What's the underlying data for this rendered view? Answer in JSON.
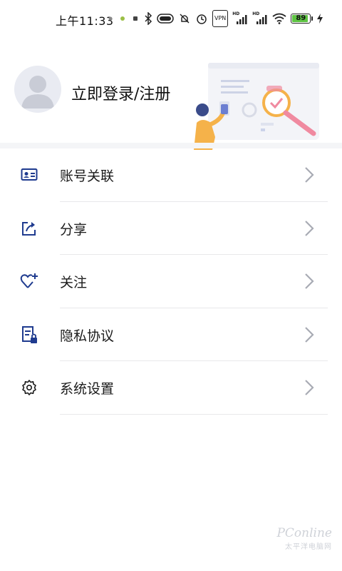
{
  "status_bar": {
    "time": "上午11:33",
    "vpn": "VPN",
    "hd1": "HD",
    "hd2": "HD",
    "battery": "89",
    "battery_color": "#5ec443"
  },
  "profile": {
    "login_label": "立即登录/注册",
    "avatar_icon": "person-silhouette-icon"
  },
  "menu": {
    "items": [
      {
        "label": "账号关联",
        "icon": "id-card-icon"
      },
      {
        "label": "分享",
        "icon": "share-icon"
      },
      {
        "label": "关注",
        "icon": "heart-plus-icon"
      },
      {
        "label": "隐私协议",
        "icon": "document-lock-icon"
      },
      {
        "label": "系统设置",
        "icon": "gear-icon"
      }
    ]
  },
  "watermark": {
    "brand": "PConline",
    "sub": "太平洋电脑网"
  },
  "colors": {
    "accent_blue": "#1f3b8f",
    "illustration_orange": "#f5b24a",
    "illustration_pink": "#f08aa0"
  }
}
